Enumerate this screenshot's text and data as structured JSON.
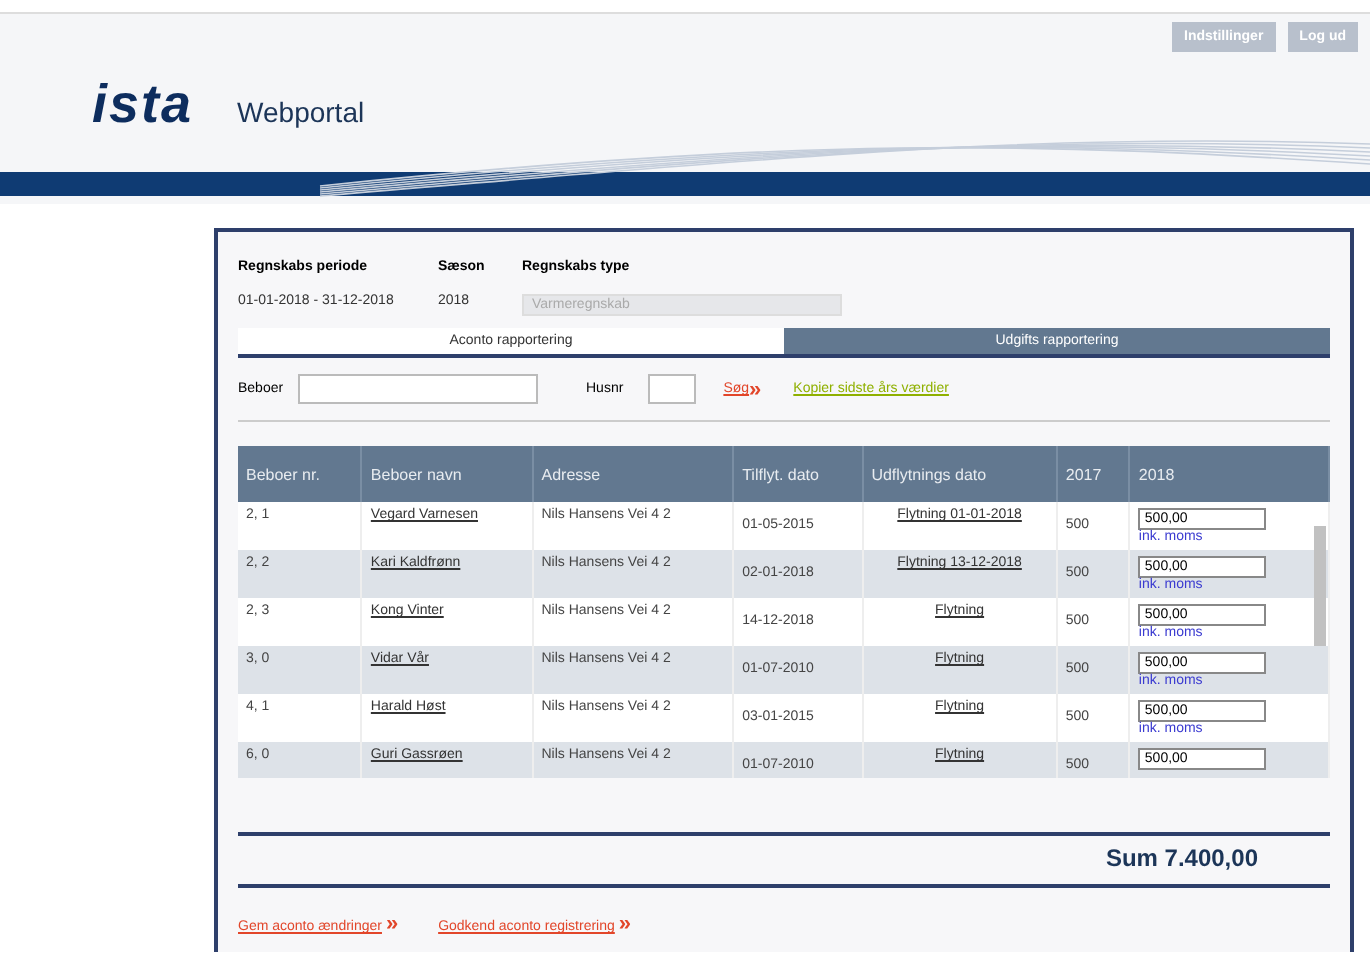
{
  "header": {
    "logo": "ista",
    "title": "Webportal",
    "buttons": [
      "Indstillinger",
      "Log ud"
    ]
  },
  "period": {
    "labels": [
      "Regnskabs periode",
      "Sæson",
      "Regnskabs type"
    ],
    "values": [
      "01-01-2018 - 31-12-2018",
      "2018"
    ],
    "type_select": {
      "value": "Varmeregnskab",
      "disabled": true
    }
  },
  "tabs": [
    {
      "label": "Aconto rapportering",
      "selected": true
    },
    {
      "label": "Udgifts rapportering",
      "selected": false
    }
  ],
  "search": {
    "beboer_label": "Beboer",
    "husnr_label": "Husnr",
    "search_link": "Søg",
    "search_icon": "»",
    "copy_link": "Kopier sidste års værdier"
  },
  "table": {
    "columns": [
      "Beboer nr.",
      "Beboer navn",
      "Adresse",
      "Tilflyt. dato",
      "Udflytnings dato",
      "2017",
      "2018"
    ],
    "rows": [
      {
        "nr": "2, 1",
        "name": "Vegard Varnesen",
        "address": "Nils Hansens Vei 4 2",
        "moved_in": "01-05-2015",
        "moved_out": "Flytning 01-01-2018",
        "prev": "500",
        "value": "500,00",
        "note": "ink. moms"
      },
      {
        "nr": "2, 2",
        "name": "Kari Kaldfrønn",
        "address": "Nils Hansens Vei 4 2",
        "moved_in": "02-01-2018",
        "moved_out": "Flytning 13-12-2018",
        "prev": "500",
        "value": "500,00",
        "note": "ink. moms"
      },
      {
        "nr": "2, 3",
        "name": "Kong Vinter",
        "address": "Nils Hansens Vei 4 2",
        "moved_in": "14-12-2018",
        "moved_out": "Flytning",
        "prev": "500",
        "value": "500,00",
        "note": "ink. moms"
      },
      {
        "nr": "3, 0",
        "name": "Vidar Vår",
        "address": "Nils Hansens Vei 4 2",
        "moved_in": "01-07-2010",
        "moved_out": "Flytning",
        "prev": "500",
        "value": "500,00",
        "note": "ink. moms"
      },
      {
        "nr": "4, 1",
        "name": "Harald Høst",
        "address": "Nils Hansens Vei 4 2",
        "moved_in": "03-01-2015",
        "moved_out": "Flytning",
        "prev": "500",
        "value": "500,00",
        "note": "ink. moms"
      },
      {
        "nr": "6, 0",
        "name": "Guri Gassrøen",
        "address": "Nils Hansens Vei 4 2",
        "moved_in": "01-07-2010",
        "moved_out": "Flytning",
        "prev": "500",
        "value": "500,00"
      }
    ],
    "sum": "Sum 7.400,00"
  },
  "footer_links": [
    {
      "label": "Gem aconto ændringer",
      "icon": "»"
    },
    {
      "label": "Godkend aconto registrering",
      "icon": "»"
    }
  ]
}
